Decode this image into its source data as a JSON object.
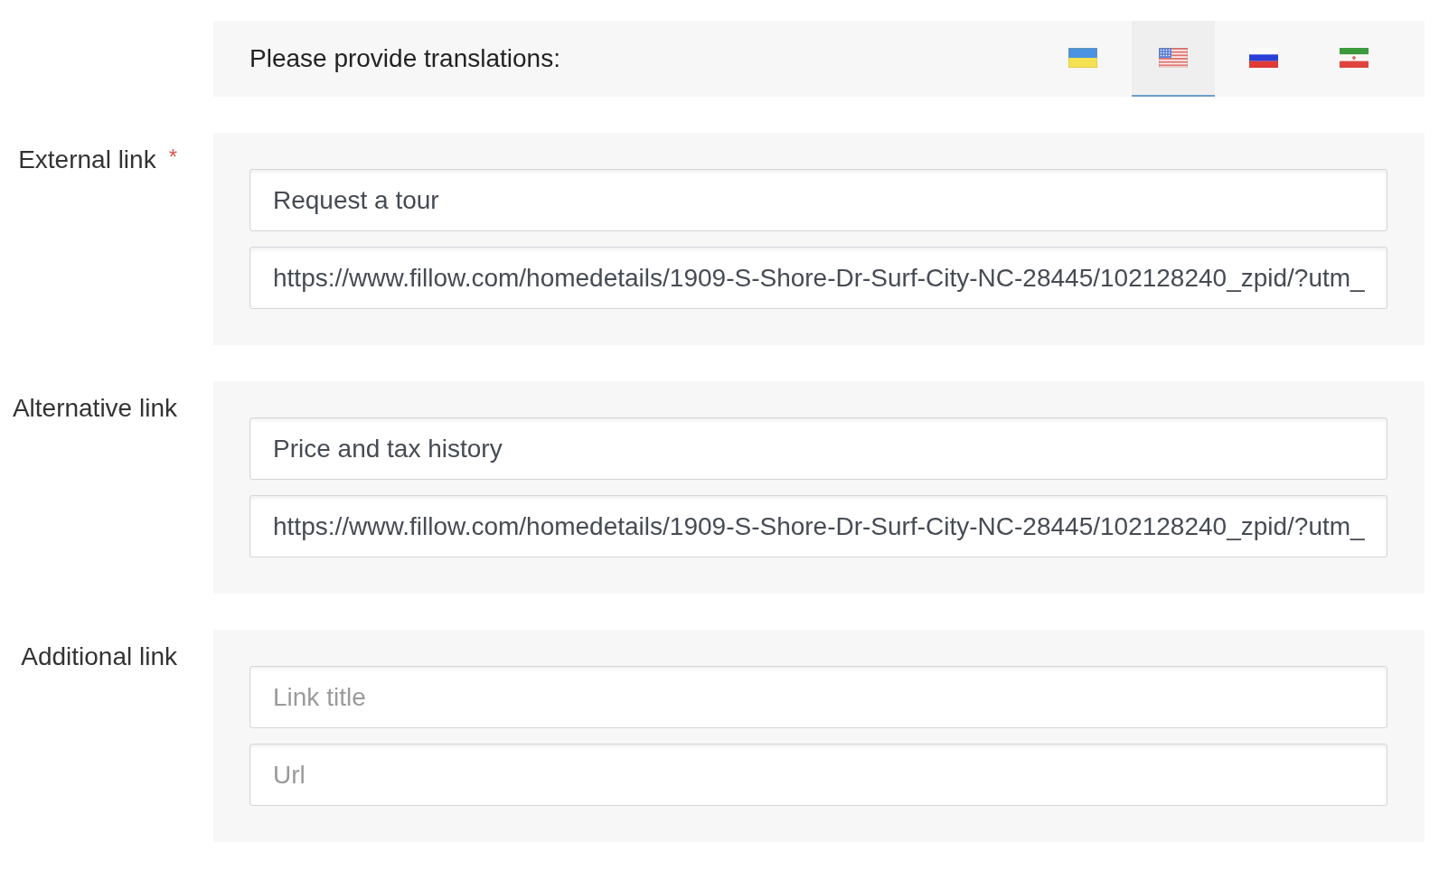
{
  "translations": {
    "label": "Please provide translations:",
    "languages": [
      {
        "kind": "ukraine",
        "selected": false
      },
      {
        "kind": "usa",
        "selected": true
      },
      {
        "kind": "russia",
        "selected": false
      },
      {
        "kind": "iran",
        "selected": false
      }
    ]
  },
  "fields": [
    {
      "label": "External link",
      "required_mark": "*",
      "inputs": [
        {
          "value": "Request a tour"
        },
        {
          "value": "https://www.fillow.com/homedetails/1909-S-Shore-Dr-Surf-City-NC-28445/102128240_zpid/?utm_"
        }
      ]
    },
    {
      "label": "Alternative link",
      "inputs": [
        {
          "value": "Price and tax history"
        },
        {
          "value": "https://www.fillow.com/homedetails/1909-S-Shore-Dr-Surf-City-NC-28445/102128240_zpid/?utm_"
        }
      ]
    },
    {
      "label": "Additional link",
      "inputs": [
        {
          "placeholder": "Link title"
        },
        {
          "placeholder": "Url"
        }
      ]
    }
  ]
}
